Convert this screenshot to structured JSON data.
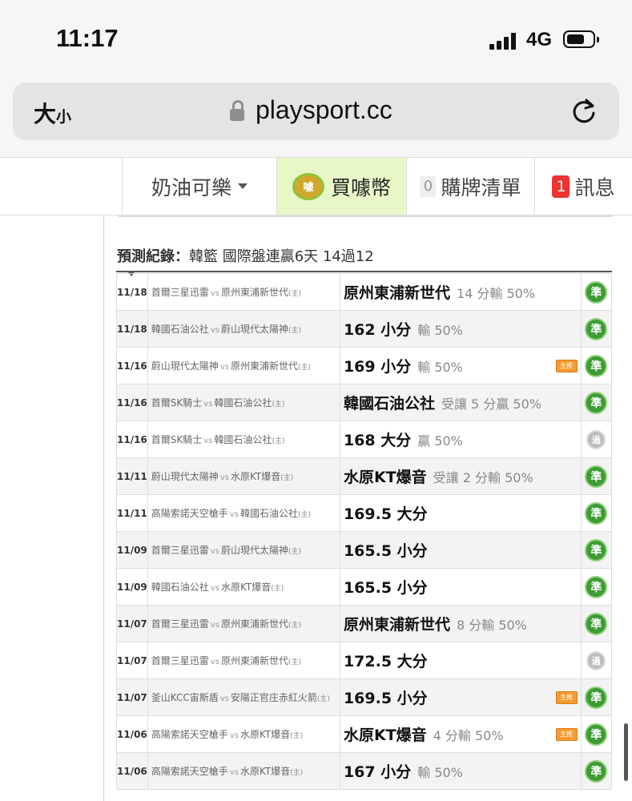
{
  "status_bar": {
    "time": "11:17",
    "network": "4G",
    "battery_level": 0.7,
    "signal_bars": 4
  },
  "browser": {
    "text_size_label": "大",
    "text_size_small": "小",
    "url": "playsport.cc",
    "icons": [
      "lock-icon",
      "reload-icon"
    ]
  },
  "nav": {
    "user_label": "奶油可樂",
    "buy_label": "買噱幣",
    "coin_text": "噱",
    "cart_count": "0",
    "cart_label": "購牌清單",
    "msg_count": "1",
    "msg_label": "訊息"
  },
  "record": {
    "label": "預測紀錄：",
    "text": "韓籃 國際盤連贏6天 14過12"
  },
  "rows": [
    {
      "date": "11/18",
      "away": "首爾三星迅雷",
      "vs": "vs",
      "home": "原州東浦新世代",
      "home_mark": "(主)",
      "pick": "原州東浦新世代",
      "detail": "14 分輸 50%",
      "tag": "",
      "status": "準",
      "status_type": "win"
    },
    {
      "date": "11/18",
      "away": "韓國石油公社",
      "vs": "vs",
      "home": "蔚山現代太陽神",
      "home_mark": "(主)",
      "pick": "162 小分",
      "detail": "輸 50%",
      "tag": "",
      "status": "準",
      "status_type": "win"
    },
    {
      "date": "11/16",
      "away": "蔚山現代太陽神",
      "vs": "vs",
      "home": "原州東浦新世代",
      "home_mark": "(主)",
      "pick": "169 小分",
      "detail": "輸 50%",
      "tag": "主推",
      "status": "準",
      "status_type": "win"
    },
    {
      "date": "11/16",
      "away": "首爾SK騎士",
      "vs": "vs",
      "home": "韓國石油公社",
      "home_mark": "(主)",
      "pick": "韓國石油公社",
      "detail": "受讓 5 分贏 50%",
      "tag": "",
      "status": "準",
      "status_type": "win"
    },
    {
      "date": "11/16",
      "away": "首爾SK騎士",
      "vs": "vs",
      "home": "韓國石油公社",
      "home_mark": "(主)",
      "pick": "168 大分",
      "detail": "贏 50%",
      "tag": "",
      "status": "過",
      "status_type": "push"
    },
    {
      "date": "11/11",
      "away": "蔚山現代太陽神",
      "vs": "vs",
      "home": "水原KT爆音",
      "home_mark": "(主)",
      "pick": "水原KT爆音",
      "detail": "受讓 2 分輸 50%",
      "tag": "",
      "status": "準",
      "status_type": "win"
    },
    {
      "date": "11/11",
      "away": "高陽索諾天空槍手",
      "vs": "vs",
      "home": "韓國石油公社",
      "home_mark": "(主)",
      "pick": "169.5 大分",
      "detail": "",
      "tag": "",
      "status": "準",
      "status_type": "win"
    },
    {
      "date": "11/09",
      "away": "首爾三星迅雷",
      "vs": "vs",
      "home": "蔚山現代太陽神",
      "home_mark": "(主)",
      "pick": "165.5 小分",
      "detail": "",
      "tag": "",
      "status": "準",
      "status_type": "win"
    },
    {
      "date": "11/09",
      "away": "韓國石油公社",
      "vs": "vs",
      "home": "水原KT爆音",
      "home_mark": "(主)",
      "pick": "165.5 小分",
      "detail": "",
      "tag": "",
      "status": "準",
      "status_type": "win"
    },
    {
      "date": "11/07",
      "away": "首爾三星迅雷",
      "vs": "vs",
      "home": "原州東浦新世代",
      "home_mark": "(主)",
      "pick": "原州東浦新世代",
      "detail": "8 分輸 50%",
      "tag": "",
      "status": "準",
      "status_type": "win"
    },
    {
      "date": "11/07",
      "away": "首爾三星迅雷",
      "vs": "vs",
      "home": "原州東浦新世代",
      "home_mark": "(主)",
      "pick": "172.5 大分",
      "detail": "",
      "tag": "",
      "status": "過",
      "status_type": "push"
    },
    {
      "date": "11/07",
      "away": "釜山KCC宙斯盾",
      "vs": "vs",
      "home": "安陽正官庄赤紅火箭",
      "home_mark": "(主)",
      "pick": "169.5 小分",
      "detail": "",
      "tag": "主推",
      "status": "準",
      "status_type": "win"
    },
    {
      "date": "11/06",
      "away": "高陽索諾天空槍手",
      "vs": "vs",
      "home": "水原KT爆音",
      "home_mark": "(主)",
      "pick": "水原KT爆音",
      "detail": "4 分輸 50%",
      "tag": "主推",
      "status": "準",
      "status_type": "win"
    },
    {
      "date": "11/06",
      "away": "高陽索諾天空槍手",
      "vs": "vs",
      "home": "水原KT爆音",
      "home_mark": "(主)",
      "pick": "167 小分",
      "detail": "輸 50%",
      "tag": "",
      "status": "準",
      "status_type": "win"
    }
  ]
}
